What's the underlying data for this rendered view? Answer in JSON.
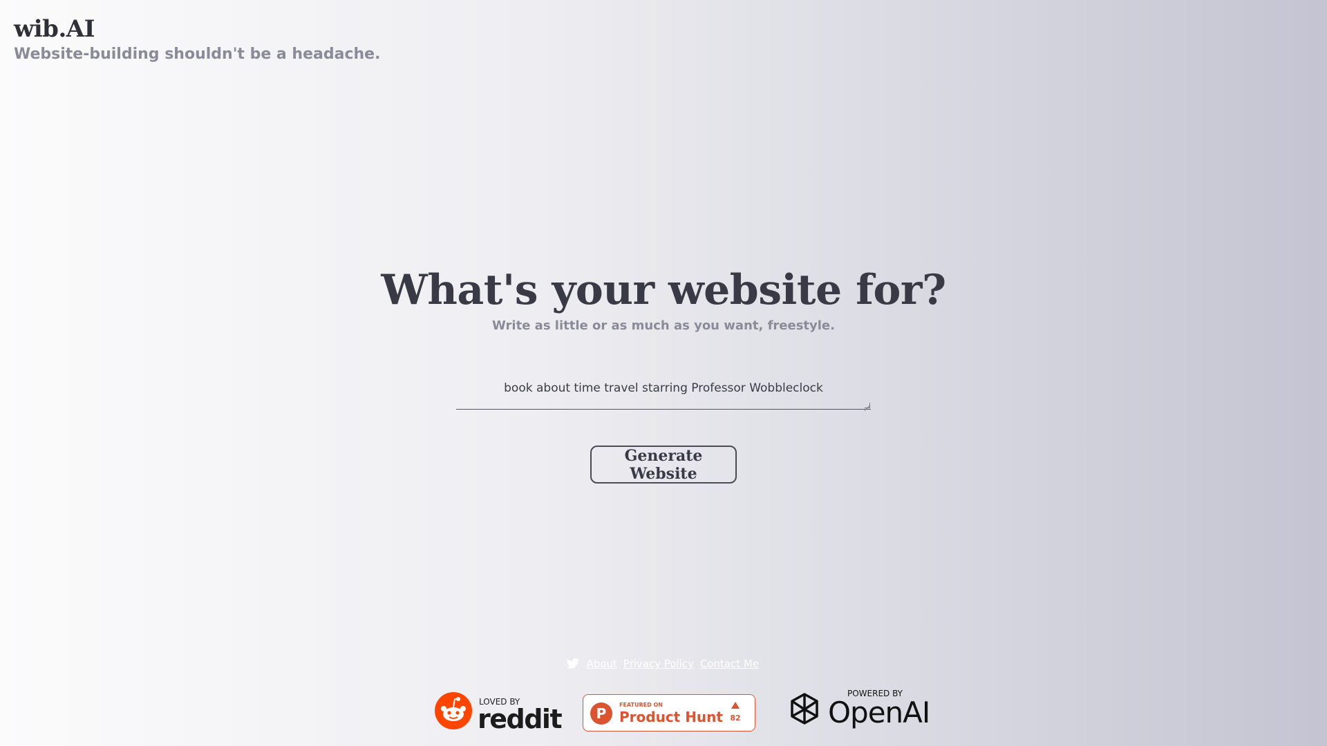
{
  "brand": {
    "title": "wib.AI",
    "tagline": "Website-building shouldn't be a headache."
  },
  "hero": {
    "title": "What's your website for?",
    "subtitle": "Write as little or as much as you want, freestyle."
  },
  "prompt": {
    "value": "book about time travel starring Professor Wobbleclock"
  },
  "generate_button": {
    "label": "Generate Website"
  },
  "footer": {
    "links": [
      "About",
      "Privacy Policy",
      "Contact Me"
    ],
    "twitter_icon": "twitter-bird-icon"
  },
  "badges": {
    "reddit": {
      "caption": "LOVED BY",
      "word": "reddit",
      "color": "#ff4500"
    },
    "producthunt": {
      "caption": "FEATURED ON",
      "name": "Product Hunt",
      "votes": "82",
      "color": "#da552f"
    },
    "openai": {
      "caption": "POWERED BY",
      "word": "OpenAI"
    }
  }
}
